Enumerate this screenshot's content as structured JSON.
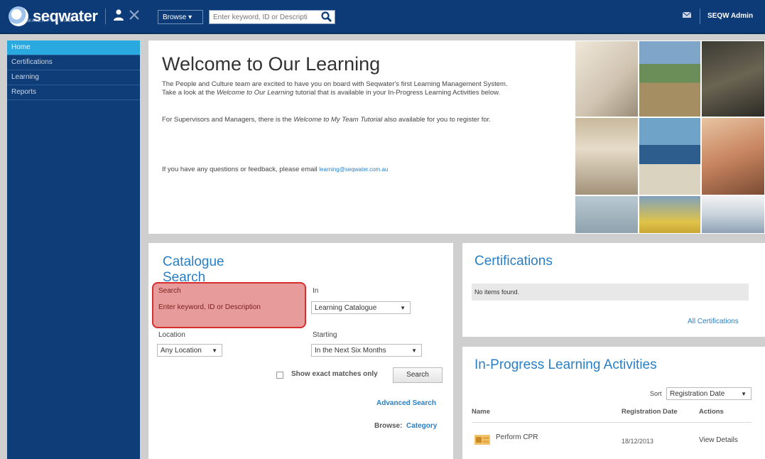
{
  "header": {
    "logo_text": "seqwater",
    "logo_sub": "WATER FOR LIFE",
    "browse_label": "Browse ▾",
    "search_placeholder": "Enter keyword, ID or Descripti",
    "admin_label": "SEQW Admin",
    "icons": [
      "user-icon",
      "tools-icon",
      "magnifier-icon",
      "mail-icon"
    ]
  },
  "sidebar": {
    "items": [
      {
        "label": "Home",
        "active": true
      },
      {
        "label": "Certifications"
      },
      {
        "label": "Learning"
      },
      {
        "label": "Reports"
      }
    ]
  },
  "welcome": {
    "title": "Welcome to Our Learning",
    "para1_a": "The People and Culture team are excited to have you on board with Seqwater's first Learning Management System. Take a look at the ",
    "para1_em": "Welcome to Our Learning",
    "para1_b": " tutorial that is available in your In-Progress Learning Activities below.",
    "para2_a": "For Supervisors and Managers, there is the ",
    "para2_em": "Welcome to My Team Tutorial",
    "para2_b": " also available for you to register for.",
    "para3": "If you have any questions or feedback, please email ",
    "email": "learning@seqwater.com.au"
  },
  "catalogue": {
    "title": "Catalogue Search",
    "search_label": "Search",
    "search_placeholder": "Enter keyword, ID or Description",
    "in_label": "In",
    "in_value": "Learning Catalogue",
    "location_label": "Location",
    "location_value": "Any Location",
    "starting_label": "Starting",
    "starting_value": "In the Next Six Months",
    "exact_label": "Show exact matches only",
    "search_button": "Search",
    "advanced_link": "Advanced Search",
    "browse_label": "Browse:",
    "category_link": "Category"
  },
  "certifications": {
    "title": "Certifications",
    "empty": "No items found.",
    "all_link": "All Certifications"
  },
  "in_progress": {
    "title": "In-Progress Learning Activities",
    "sort_label": "Sort",
    "sort_value": "Registration Date",
    "columns": [
      "Name",
      "Registration Date",
      "Actions"
    ],
    "rows": [
      {
        "name": "Perform CPR",
        "date": "18/12/2013",
        "action": "View Details"
      }
    ]
  },
  "colors": {
    "topbar": "#0d3b78",
    "sidebar": "#0f3d77",
    "sidebar_active": "#2aa8e0",
    "link": "#2a7fc4",
    "highlight_border": "#d62e2e"
  }
}
